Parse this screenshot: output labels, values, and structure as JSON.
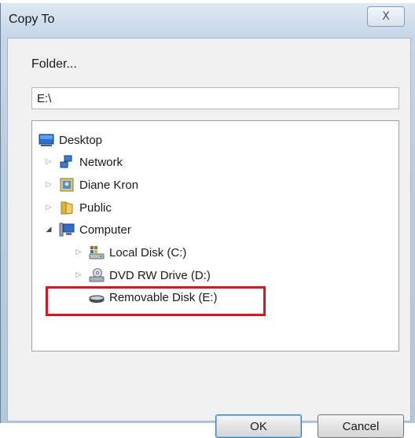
{
  "dialog": {
    "title": "Copy To",
    "close_label": "X"
  },
  "folder": {
    "label": "Folder...",
    "path_value": "E:\\"
  },
  "tree": {
    "items": [
      {
        "label": "Desktop",
        "icon": "desktop-icon",
        "expander": "none"
      },
      {
        "label": "Network",
        "icon": "network-icon",
        "expander": "collapsed"
      },
      {
        "label": "Diane Kron",
        "icon": "user-folder-icon",
        "expander": "collapsed"
      },
      {
        "label": "Public",
        "icon": "folder-icon",
        "expander": "collapsed"
      },
      {
        "label": "Computer",
        "icon": "computer-icon",
        "expander": "expanded"
      },
      {
        "label": "Local Disk (C:)",
        "icon": "local-disk-icon",
        "expander": "collapsed"
      },
      {
        "label": "DVD RW Drive (D:)",
        "icon": "dvd-drive-icon",
        "expander": "collapsed"
      },
      {
        "label": "Removable Disk (E:)",
        "icon": "removable-disk-icon",
        "expander": "none"
      }
    ]
  },
  "buttons": {
    "ok": "OK",
    "cancel": "Cancel"
  },
  "colors": {
    "highlight": "#e0141e",
    "window_frame": "#c5d7ea"
  }
}
